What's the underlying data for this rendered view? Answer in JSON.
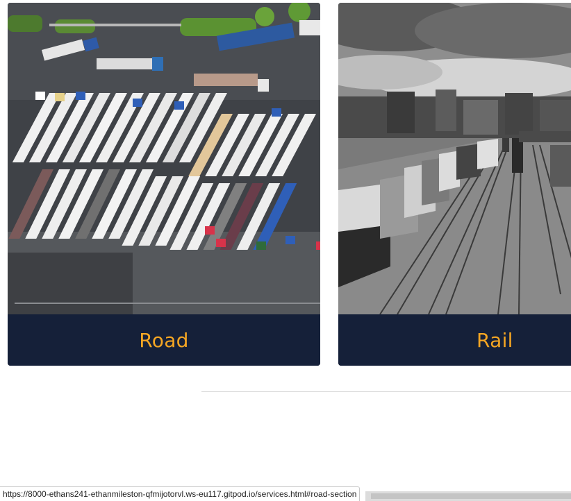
{
  "services": {
    "road": {
      "title": "Road"
    },
    "rail": {
      "title": "Rail"
    }
  },
  "status_bar": {
    "url": "https://8000-ethans241-ethanmileston-qfmijotorvl.ws-eu117.gitpod.io/services.html#road-section"
  },
  "colors": {
    "card_caption_bg": "#152039",
    "card_title": "#f5a623"
  }
}
